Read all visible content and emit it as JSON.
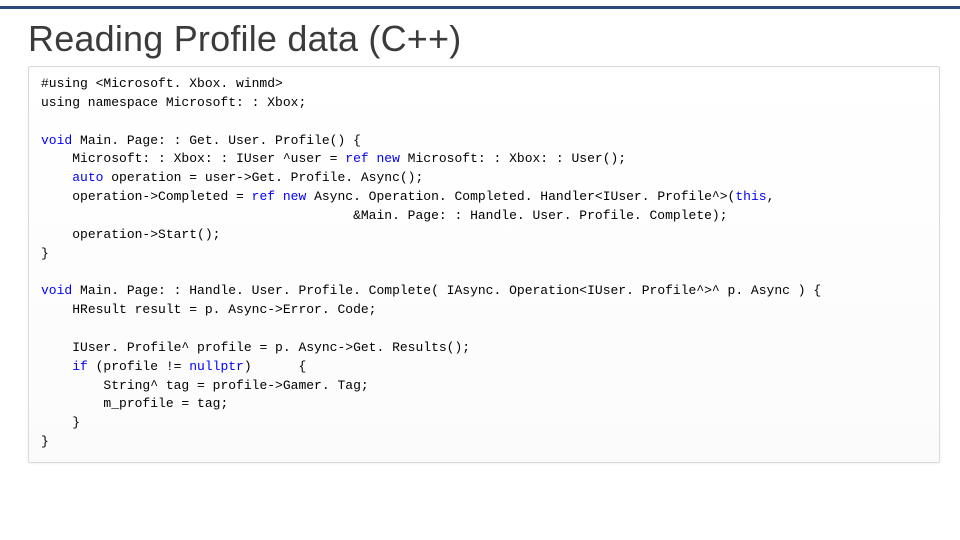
{
  "slide": {
    "title": "Reading Profile data (C++)"
  },
  "code": {
    "lines": [
      {
        "i": 0,
        "pre": "",
        "kw": "",
        "txt": "#using <Microsoft. Xbox. winmd>"
      },
      {
        "i": 0,
        "pre": "",
        "kw": "",
        "txt": "using namespace Microsoft: : Xbox;"
      },
      {
        "i": 0,
        "pre": "",
        "kw": "",
        "txt": ""
      },
      {
        "i": 0,
        "kw": "void",
        "txt": " Main. Page: : Get. User. Profile() {"
      },
      {
        "i": 1,
        "pre": "Microsoft: : Xbox: : IUser ^user = ",
        "kw": "ref new",
        "txt": " Microsoft: : Xbox: : User();"
      },
      {
        "i": 1,
        "kw": "auto",
        "txt": " operation = user->Get. Profile. Async();"
      },
      {
        "i": 1,
        "pre": "operation->Completed = ",
        "kw": "ref new",
        "txt": " Async. Operation. Completed. Handler<IUser. Profile^>(",
        "kw2": "this",
        "post": ","
      },
      {
        "i": 10,
        "pre": "",
        "kw": "",
        "txt": "&Main. Page: : Handle. User. Profile. Complete);"
      },
      {
        "i": 1,
        "pre": "",
        "kw": "",
        "txt": "operation->Start();"
      },
      {
        "i": 0,
        "pre": "",
        "kw": "",
        "txt": "}"
      },
      {
        "i": 0,
        "pre": "",
        "kw": "",
        "txt": ""
      },
      {
        "i": 0,
        "kw": "void",
        "txt": " Main. Page: : Handle. User. Profile. Complete( IAsync. Operation<IUser. Profile^>^ p. Async ) {"
      },
      {
        "i": 1,
        "pre": "",
        "kw": "",
        "txt": "HResult result = p. Async->Error. Code;"
      },
      {
        "i": 0,
        "pre": "",
        "kw": "",
        "txt": ""
      },
      {
        "i": 1,
        "pre": "",
        "kw": "",
        "txt": "IUser. Profile^ profile = p. Async->Get. Results();"
      },
      {
        "i": 1,
        "kw": "if",
        "txt": " (profile != ",
        "kw2": "nullptr",
        "post": ")      {"
      },
      {
        "i": 2,
        "pre": "",
        "kw": "",
        "txt": "String^ tag = profile->Gamer. Tag;"
      },
      {
        "i": 2,
        "pre": "",
        "kw": "",
        "txt": "m_profile = tag;"
      },
      {
        "i": 1,
        "pre": "",
        "kw": "",
        "txt": "}"
      },
      {
        "i": 0,
        "pre": "",
        "kw": "",
        "txt": "}"
      }
    ]
  }
}
